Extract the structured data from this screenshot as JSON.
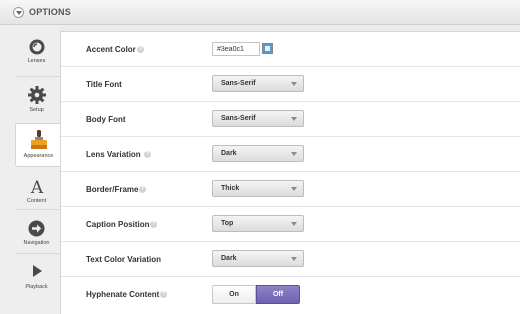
{
  "header": {
    "title": "OPTIONS"
  },
  "sidebar": {
    "items": [
      {
        "label": "Lenses",
        "icon": "lens-icon"
      },
      {
        "label": "Setup",
        "icon": "gear-icon"
      },
      {
        "label": "Appearance",
        "icon": "brush-icon",
        "active": true
      },
      {
        "label": "Content",
        "icon": "serif-a-icon"
      },
      {
        "label": "Navigation",
        "icon": "arrow-circle-icon"
      },
      {
        "label": "Playback",
        "icon": "play-icon"
      }
    ]
  },
  "options": {
    "accent_color": {
      "label": "Accent Color",
      "value": "#3ea0c1"
    },
    "title_font": {
      "label": "Title Font",
      "value": "Sans-Serif"
    },
    "body_font": {
      "label": "Body Font",
      "value": "Sans-Serif"
    },
    "lens_variation": {
      "label": "Lens Variation",
      "value": "Dark"
    },
    "border_frame": {
      "label": "Border/Frame",
      "value": "Thick"
    },
    "caption_position": {
      "label": "Caption Position",
      "value": "Top"
    },
    "text_color_variation": {
      "label": "Text Color Variation",
      "value": "Dark"
    },
    "hyphenate_content": {
      "label": "Hyphenate Content",
      "on_label": "On",
      "off_label": "Off",
      "selected": "Off"
    }
  },
  "colors": {
    "toggle_active": "#7a6fbc",
    "swatch": "#5a9ad0"
  }
}
